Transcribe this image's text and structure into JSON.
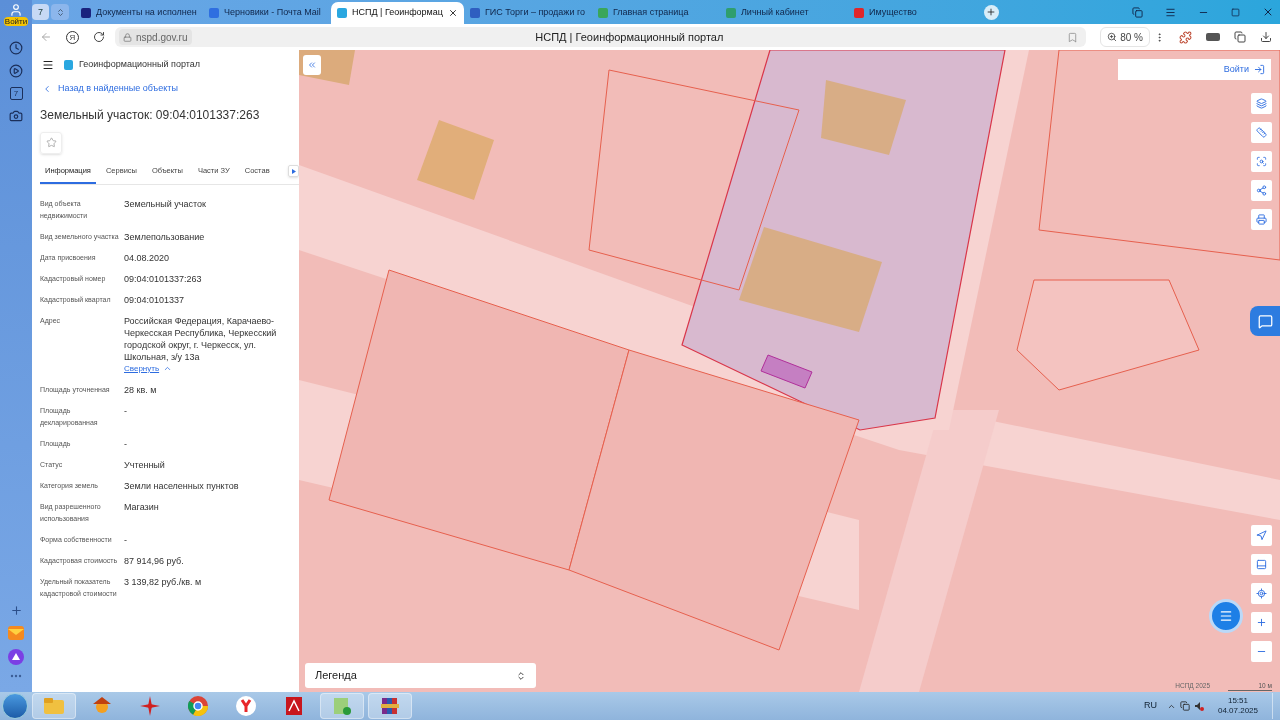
{
  "browser": {
    "profile_label": "Войти",
    "tab_counter": "7",
    "tabs": [
      {
        "title": "Документы на исполнен",
        "selected": false,
        "color": "#1a237e"
      },
      {
        "title": "Черновики - Почта Mail",
        "selected": false,
        "color": "#2f6fe0"
      },
      {
        "title": "НСПД | Геоинформац",
        "selected": true,
        "color": "#2aa7e0"
      },
      {
        "title": "ГИС Торги – продажи го",
        "selected": false,
        "color": "#2f5fc0"
      },
      {
        "title": "Главная страница",
        "selected": false,
        "color": "#3aa65a"
      },
      {
        "title": "Личный кабинет",
        "selected": false,
        "color": "#2f9e6e"
      },
      {
        "title": "Имущество",
        "selected": false,
        "color": "#e0262a"
      }
    ],
    "logo": "Я",
    "url": "nspd.gov.ru",
    "page_title": "НСПД | Геоинформационный портал",
    "zoom": "80 %",
    "calendar_day": "7"
  },
  "panel": {
    "portal_title": "Геоинформационный портал",
    "back_link": "Назад в найденные объекты",
    "object_title": "Земельный участок: 09:04:0101337:263",
    "favorite": false,
    "tabs": [
      {
        "label": "Информация",
        "selected": true
      },
      {
        "label": "Сервисы",
        "selected": false
      },
      {
        "label": "Объекты",
        "selected": false
      },
      {
        "label": "Части ЗУ",
        "selected": false
      },
      {
        "label": "Состав",
        "selected": false
      }
    ],
    "fields": [
      {
        "label": "Вид объекта недвижимости",
        "value": "Земельный участок"
      },
      {
        "label": "Вид земельного участка",
        "value": "Землепользование"
      },
      {
        "label": "Дата присвоения",
        "value": "04.08.2020"
      },
      {
        "label": "Кадастровый номер",
        "value": "09:04:0101337:263"
      },
      {
        "label": "Кадастровый квартал",
        "value": "09:04:0101337"
      },
      {
        "label": "Адрес",
        "value": "Российская Федерация, Карачаево-Черкесская Республика, Черкесский городской округ, г. Черкесск, ул. Школьная, з/у 13а",
        "toggle": {
          "label": "Свернуть",
          "expanded": true
        }
      },
      {
        "label": "Площадь уточненная",
        "value": "28 кв. м"
      },
      {
        "label": "Площадь декларированная",
        "value": "-"
      },
      {
        "label": "Площадь",
        "value": "-"
      },
      {
        "label": "Статус",
        "value": "Учтенный"
      },
      {
        "label": "Категория земель",
        "value": "Земли населенных пунктов"
      },
      {
        "label": "Вид разрешенного использования",
        "value": "Магазин"
      },
      {
        "label": "Форма собственности",
        "value": "-"
      },
      {
        "label": "Кадастровая стоимость",
        "value": "87 914,96 руб."
      },
      {
        "label": "Удельный показатель кадастровой стоимости",
        "value": "3 139,82 руб./кв. м"
      }
    ]
  },
  "map": {
    "login": "Войти",
    "legend": "Легенда",
    "attribution": "НСПД 2025",
    "scale": "10 м"
  },
  "taskbar": {
    "language": "RU",
    "time": "15:51",
    "date": "04.07.2025"
  }
}
